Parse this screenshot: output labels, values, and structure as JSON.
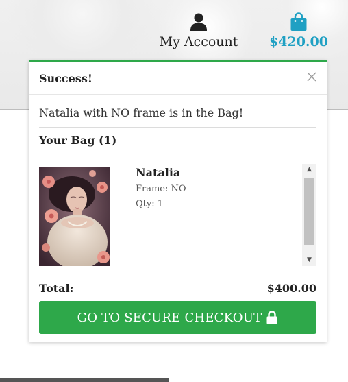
{
  "header": {
    "account_label": "My Account",
    "bag_total": "$420.00",
    "icons": {
      "account": "user-icon",
      "bag": "shopping-bag-icon"
    },
    "bag_color": "#1fa0c3"
  },
  "popup": {
    "title": "Success!",
    "close_icon": "close-icon",
    "message": "Natalia with NO frame is in the Bag!",
    "bag_title": "Your Bag (1)",
    "accent_color": "#2ea84a",
    "items": [
      {
        "name": "Natalia",
        "frame": "Frame: NO",
        "qty": "Qty: 1",
        "thumbnail": "artwork-thumbnail"
      }
    ],
    "total_label": "Total:",
    "total_value": "$400.00",
    "checkout_label": "GO TO SECURE CHECKOUT",
    "checkout_icon": "lock-icon"
  }
}
